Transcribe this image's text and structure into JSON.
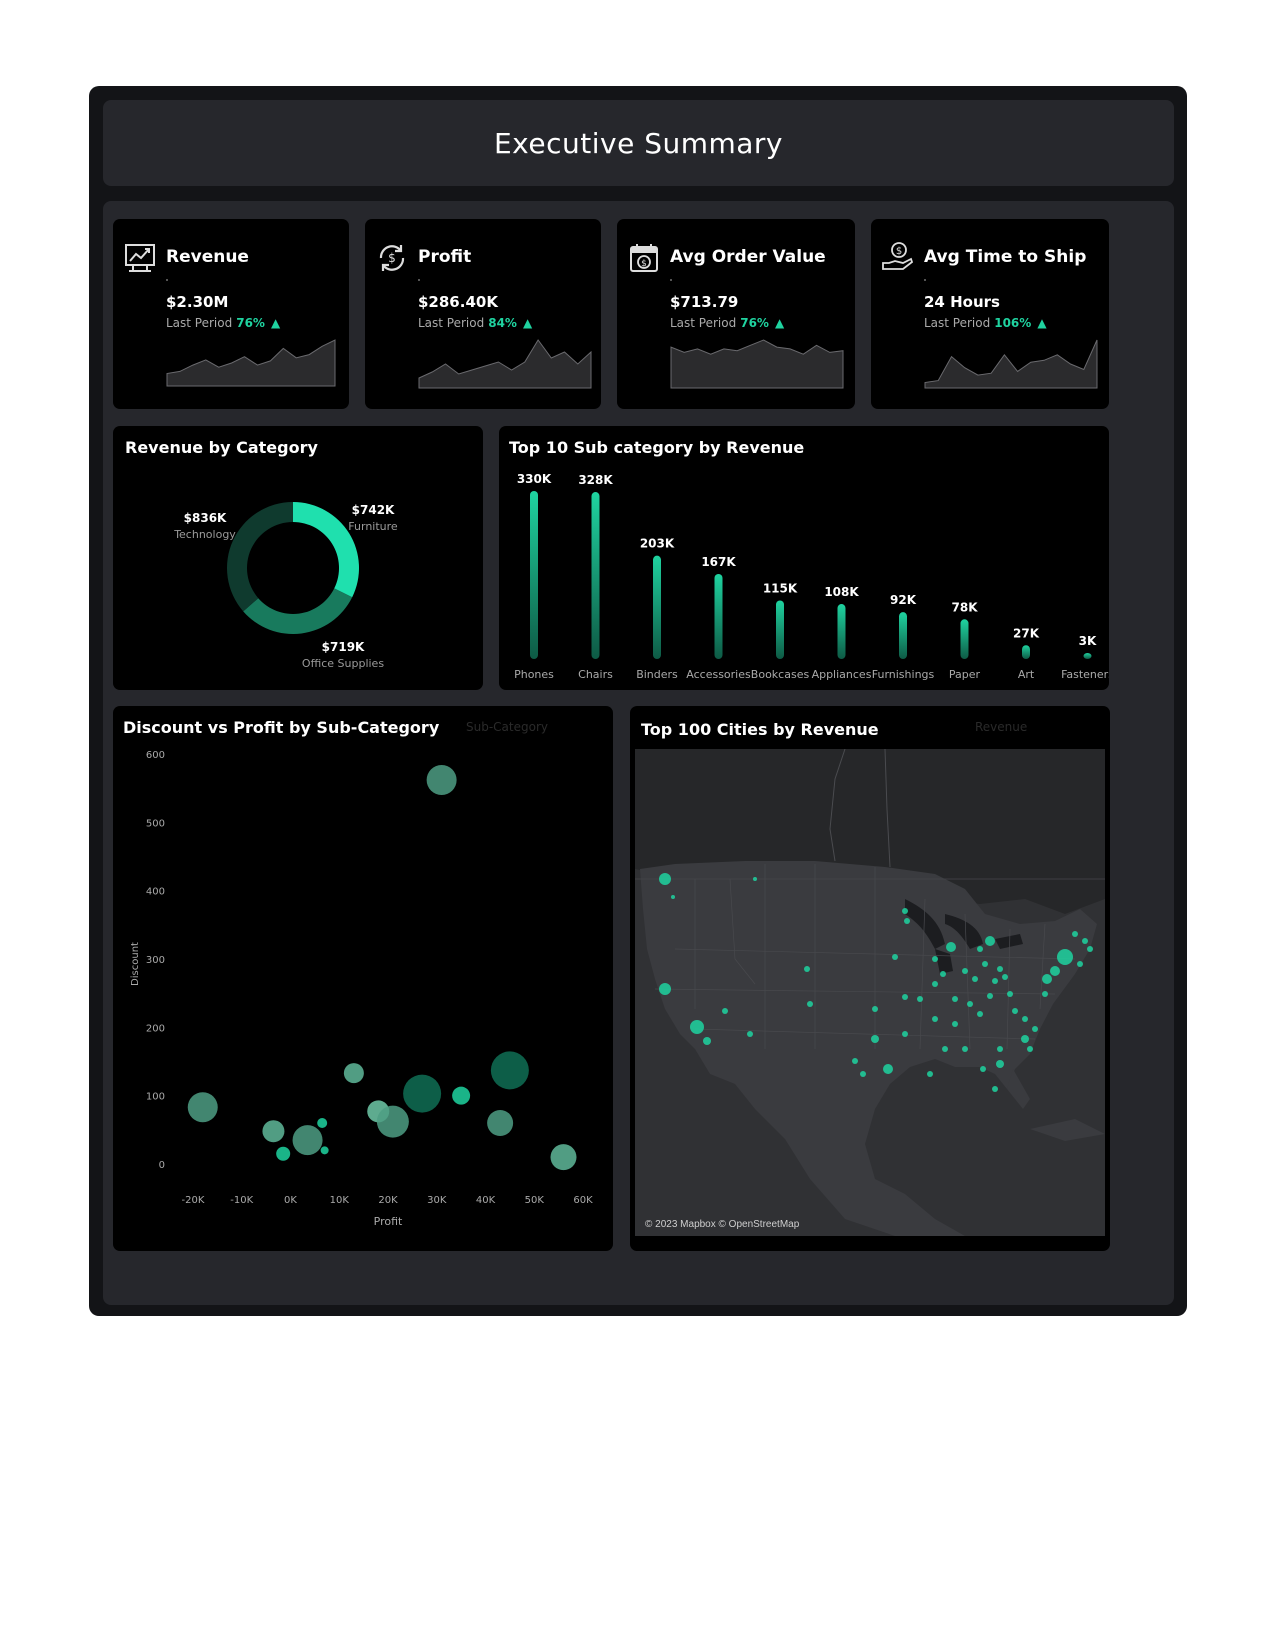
{
  "title": "Executive Summary",
  "colors": {
    "accent": "#1fd3a0",
    "panel": "#26272c",
    "card": "#000000",
    "frame": "#131417"
  },
  "kpis": [
    {
      "icon": "line-chart-icon",
      "title": "Revenue",
      "value": "$2.30M",
      "last_label": "Last Period",
      "pct": "76%",
      "trend": "up",
      "spark": [
        12,
        14,
        20,
        25,
        18,
        22,
        28,
        20,
        24,
        36,
        27,
        30,
        38,
        44
      ]
    },
    {
      "icon": "refresh-dollar-icon",
      "title": "Profit",
      "value": "$286.40K",
      "last_label": "Last Period",
      "pct": "84%",
      "trend": "up",
      "spark": [
        10,
        16,
        24,
        14,
        18,
        22,
        26,
        18,
        26,
        48,
        30,
        36,
        24,
        36
      ]
    },
    {
      "icon": "calendar-dollar-icon",
      "title": "Avg Order Value",
      "value": "$713.79",
      "last_label": "Last Period",
      "pct": "76%",
      "trend": "up",
      "spark": [
        46,
        40,
        44,
        38,
        44,
        42,
        48,
        54,
        46,
        44,
        38,
        48,
        40,
        42
      ]
    },
    {
      "icon": "hand-coin-icon",
      "title": "Avg Time to Ship",
      "value": "24 Hours",
      "last_label": "Last Period",
      "pct": "106%",
      "trend": "up",
      "spark": [
        6,
        8,
        34,
        22,
        14,
        16,
        36,
        18,
        28,
        30,
        36,
        26,
        20,
        52
      ]
    }
  ],
  "revenue_by_category": {
    "title": "Revenue by Category",
    "chart_data": {
      "type": "pie",
      "slices": [
        {
          "label": "Furniture",
          "value_label": "$742K",
          "value": 742,
          "color": "#1fe0ae"
        },
        {
          "label": "Office Supplies",
          "value_label": "$719K",
          "value": 719,
          "color": "#187a5d"
        },
        {
          "label": "Technology",
          "value_label": "$836K",
          "value": 836,
          "color": "#0f3a2e"
        }
      ]
    }
  },
  "top_subcategories": {
    "title": "Top 10 Sub category by Revenue",
    "chart_data": {
      "type": "bar",
      "categories": [
        "Phones",
        "Chairs",
        "Binders",
        "Accessories",
        "Bookcases",
        "Appliances",
        "Furnishings",
        "Paper",
        "Art",
        "Fasteners"
      ],
      "values": [
        330,
        328,
        203,
        167,
        115,
        108,
        92,
        78,
        27,
        3
      ],
      "value_labels": [
        "330K",
        "328K",
        "203K",
        "167K",
        "115K",
        "108K",
        "92K",
        "78K",
        "27K",
        "3K"
      ],
      "ylim": [
        0,
        330
      ]
    }
  },
  "scatter": {
    "title": "Discount vs Profit by Sub-Category",
    "ghost_label": "Sub-Category",
    "chart_data": {
      "type": "scatter",
      "xlabel": "Profit",
      "ylabel": "Discount",
      "xlim": [
        -25,
        62
      ],
      "ylim": [
        0,
        620
      ],
      "xticks": [
        -20,
        -10,
        0,
        10,
        20,
        30,
        40,
        50,
        60
      ],
      "xtick_labels": [
        "-20K",
        "-10K",
        "0K",
        "10K",
        "20K",
        "30K",
        "40K",
        "50K",
        "60K"
      ],
      "yticks": [
        0,
        100,
        200,
        300,
        400,
        500,
        600
      ],
      "ytick_labels": [
        "0",
        "100",
        "200",
        "300",
        "400",
        "500",
        "600"
      ],
      "points": [
        {
          "x": -18,
          "y": 83,
          "r": 15,
          "color": "#4e9e84"
        },
        {
          "x": -3.5,
          "y": 48,
          "r": 11,
          "color": "#5fb89a"
        },
        {
          "x": -1.5,
          "y": 15,
          "r": 7,
          "color": "#1fd3a0"
        },
        {
          "x": 3.5,
          "y": 35,
          "r": 15,
          "color": "#4e9e84"
        },
        {
          "x": 6.5,
          "y": 60,
          "r": 5,
          "color": "#1fd3a0"
        },
        {
          "x": 7,
          "y": 20,
          "r": 4,
          "color": "#1fd3a0"
        },
        {
          "x": 13,
          "y": 133,
          "r": 10,
          "color": "#5fb89a"
        },
        {
          "x": 18,
          "y": 77,
          "r": 11,
          "color": "#6ec9a8"
        },
        {
          "x": 21,
          "y": 62,
          "r": 16,
          "color": "#4e9e84"
        },
        {
          "x": 27,
          "y": 103,
          "r": 19,
          "color": "#0f6e55"
        },
        {
          "x": 31,
          "y": 562,
          "r": 15,
          "color": "#4e9e84"
        },
        {
          "x": 35,
          "y": 100,
          "r": 9,
          "color": "#1fd3a0"
        },
        {
          "x": 43,
          "y": 60,
          "r": 13,
          "color": "#4e9e84"
        },
        {
          "x": 45,
          "y": 137,
          "r": 19,
          "color": "#0f6e55"
        },
        {
          "x": 56,
          "y": 10,
          "r": 13,
          "color": "#5fb89a"
        }
      ]
    }
  },
  "map": {
    "title": "Top 100 Cities by Revenue",
    "ghost_label": "Revenue",
    "credit": "© 2023 Mapbox © OpenStreetMap"
  }
}
